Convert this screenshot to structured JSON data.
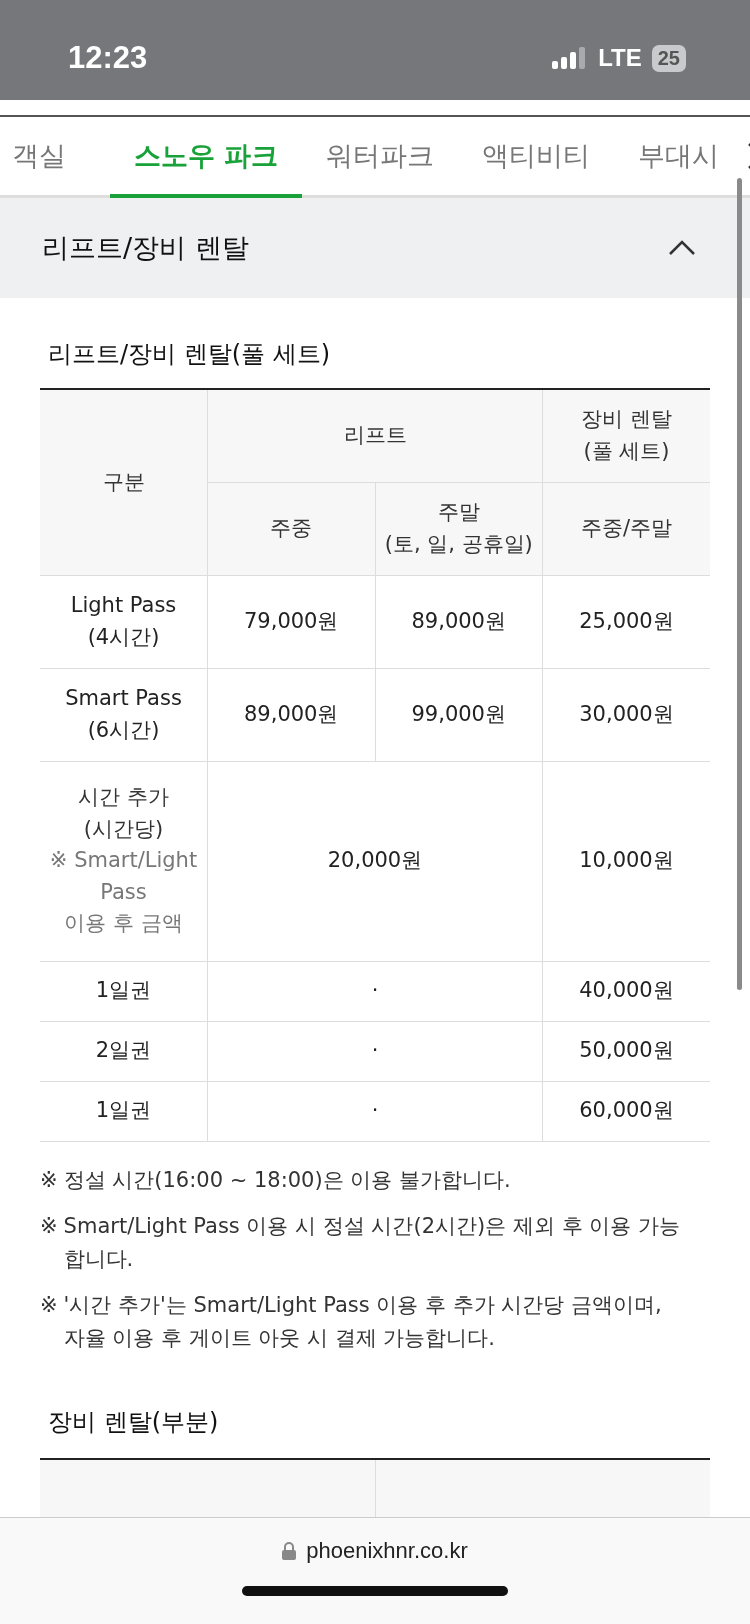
{
  "status_bar": {
    "time": "12:23",
    "network": "LTE",
    "battery": "25"
  },
  "tabs": [
    {
      "label": "객실",
      "selected": false
    },
    {
      "label": "스노우 파크",
      "selected": true
    },
    {
      "label": "워터파크",
      "selected": false
    },
    {
      "label": "액티비티",
      "selected": false
    },
    {
      "label": "부대시",
      "selected": false
    }
  ],
  "section": {
    "title": "리프트/장비 렌탈",
    "expanded": true
  },
  "full_set_table": {
    "title": "리프트/장비 렌탈(풀 세트)",
    "header": {
      "category": "구분",
      "lift": "리프트",
      "lift_weekday": "주중",
      "lift_weekend": "주말\n(토, 일, 공휴일)",
      "rental": "장비 렌탈\n(풀 세트)",
      "rental_days": "주중/주말"
    },
    "rows": [
      {
        "kind": "split",
        "name": "Light Pass\n(4시간)",
        "cells": [
          "79,000원",
          "89,000원",
          "25,000원"
        ]
      },
      {
        "kind": "split",
        "name": "Smart Pass\n(6시간)",
        "cells": [
          "89,000원",
          "99,000원",
          "30,000원"
        ]
      },
      {
        "kind": "merged",
        "name": "시간 추가\n(시간당)",
        "note": "※ Smart/Light\nPass\n이용 후 금액",
        "cells": [
          "20,000원",
          "10,000원"
        ]
      },
      {
        "kind": "merged",
        "name": "1일권",
        "cells": [
          "·",
          "40,000원"
        ]
      },
      {
        "kind": "merged",
        "name": "2일권",
        "cells": [
          "·",
          "50,000원"
        ]
      },
      {
        "kind": "merged",
        "name": "1일권",
        "cells": [
          "·",
          "60,000원"
        ]
      }
    ]
  },
  "notes": [
    {
      "mark": "※",
      "text": "정설 시간(16:00 ~ 18:00)은 이용 불가합니다."
    },
    {
      "mark": "※",
      "text": "Smart/Light Pass 이용 시 정설 시간(2시간)은 제외 후 이용 가능\n합니다."
    },
    {
      "mark": "※",
      "text": "'시간 추가'는 Smart/Light Pass 이용 후 추가 시간당 금액이며,\n자율 이용 후 게이트 아웃 시 결제 가능합니다."
    }
  ],
  "partial_table": {
    "title": "장비 렌탈(부분)"
  },
  "browser_bar": {
    "url": "phoenixhnr.co.kr"
  }
}
